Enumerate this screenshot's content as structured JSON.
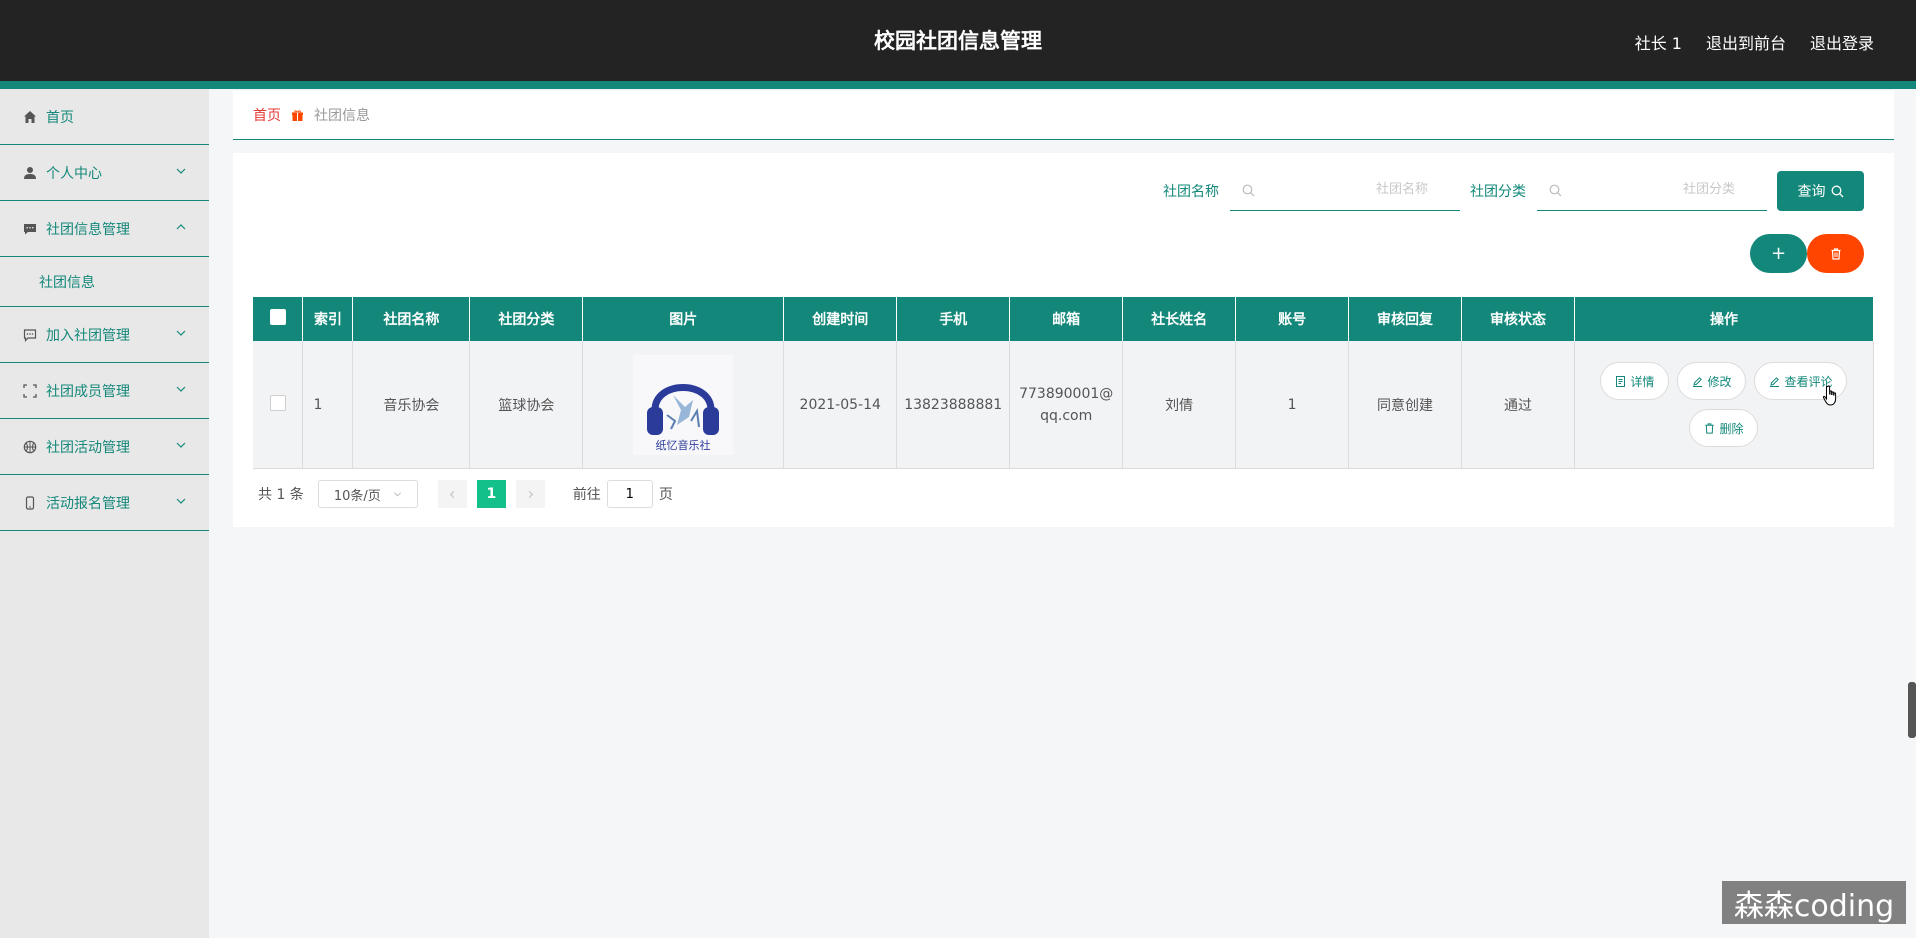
{
  "header": {
    "title": "校园社团信息管理",
    "user_label": "社长 1",
    "exit_front_label": "退出到前台",
    "logout_label": "退出登录"
  },
  "sidebar": {
    "items": [
      {
        "label": "首页",
        "icon": "home-icon"
      },
      {
        "label": "个人中心",
        "icon": "user-icon"
      },
      {
        "label": "社团信息管理",
        "icon": "message-icon",
        "expanded": true,
        "children": [
          {
            "label": "社团信息"
          }
        ]
      },
      {
        "label": "加入社团管理",
        "icon": "chat-icon"
      },
      {
        "label": "社团成员管理",
        "icon": "crop-icon"
      },
      {
        "label": "社团活动管理",
        "icon": "basketball-icon"
      },
      {
        "label": "活动报名管理",
        "icon": "mobile-icon"
      }
    ]
  },
  "breadcrumb": {
    "home": "首页",
    "current": "社团信息"
  },
  "search": {
    "name_label": "社团名称",
    "name_placeholder": "社团名称",
    "category_label": "社团分类",
    "category_placeholder": "社团分类",
    "query_label": "查询"
  },
  "actions": {
    "add_label": "+"
  },
  "table": {
    "headers": [
      "索引",
      "社团名称",
      "社团分类",
      "图片",
      "创建时间",
      "手机",
      "邮箱",
      "社长姓名",
      "账号",
      "审核回复",
      "审核状态",
      "操作"
    ],
    "rows": [
      {
        "index": "1",
        "name": "音乐协会",
        "category": "篮球协会",
        "image_caption": "纸忆音乐社",
        "created": "2021-05-14",
        "phone": "13823888881",
        "email_line1": "773890001@",
        "email_line2": "qq.com",
        "leader": "刘倩",
        "account": "1",
        "reply": "同意创建",
        "status": "通过"
      }
    ],
    "ops": {
      "detail": "详情",
      "edit": "修改",
      "comments": "查看评论",
      "delete": "删除"
    }
  },
  "pagination": {
    "total": "共 1 条",
    "page_size": "10条/页",
    "current_page": "1",
    "goto_label": "前往",
    "goto_value": "1",
    "page_unit": "页"
  },
  "watermark": "森森coding",
  "colors": {
    "primary": "#13887a",
    "danger": "#ff4500",
    "topbar": "#232323"
  }
}
